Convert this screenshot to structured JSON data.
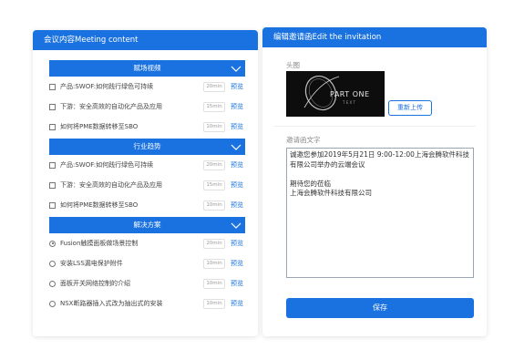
{
  "left_panel": {
    "title": "会议内容Meeting content",
    "sections": [
      {
        "title": "赋场视频",
        "control": "checkbox",
        "items": [
          {
            "title": "产品:SWOF:如何践行绿色可持续",
            "duration": "20min",
            "action": "预览",
            "checked": false
          },
          {
            "title": "下游：安全高效的自动化产品及应用",
            "duration": "15min",
            "action": "预览",
            "checked": false
          },
          {
            "title": "如何将PME数据转移至SBO",
            "duration": "10min",
            "action": "预览",
            "checked": false
          }
        ]
      },
      {
        "title": "行业趋势",
        "control": "checkbox",
        "items": [
          {
            "title": "产品:SWOF:如何践行绿色可持续",
            "duration": "20min",
            "action": "预览",
            "checked": false
          },
          {
            "title": "下游：安全高效的自动化产品及应用",
            "duration": "15min",
            "action": "预览",
            "checked": false
          },
          {
            "title": "如何将PME数据转移至SBO",
            "duration": "10min",
            "action": "预览",
            "checked": false
          }
        ]
      },
      {
        "title": "解决方案",
        "control": "radio",
        "items": [
          {
            "title": "Fusion触摸面板做场景控制",
            "duration": "20min",
            "action": "预览",
            "checked": true
          },
          {
            "title": "安装LSS漏电保护附件",
            "duration": "10min",
            "action": "预览",
            "checked": false
          },
          {
            "title": "面板开关网络控制的介绍",
            "duration": "10min",
            "action": "预览",
            "checked": false
          },
          {
            "title": "NSX断路器插入式改为抽出式的安装",
            "duration": "10min",
            "action": "预览",
            "checked": false
          }
        ]
      }
    ]
  },
  "right_panel": {
    "title": "编辑邀请函Edit the invitation",
    "avatar_label": "头图",
    "logo_text": "PART ONE",
    "logo_sub": "T E X T",
    "reupload_label": "重新上传",
    "text_label": "邀请函文字",
    "invitation_text": "诚邀您参加2019年5月21日 9:00-12:00上海会腾软件科技\n有限公司举办的云端会议\n\n期待您的莅临\n上海会腾软件科技有限公司",
    "save_label": "保存"
  },
  "colors": {
    "accent": "#1a72e0"
  }
}
